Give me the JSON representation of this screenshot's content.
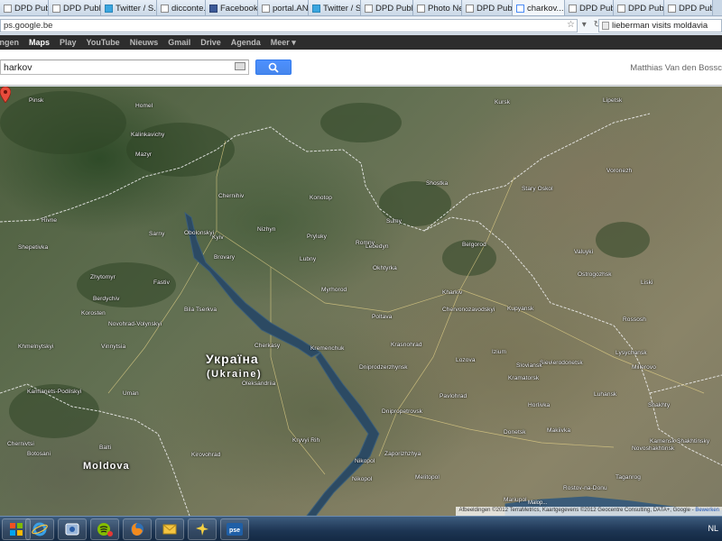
{
  "browser": {
    "tabs": [
      {
        "label": "DPD Publi...",
        "icon": "document-icon"
      },
      {
        "label": "DPD Publi...",
        "icon": "document-icon"
      },
      {
        "label": "Twitter / S...",
        "icon": "twitter-icon"
      },
      {
        "label": "dicconte...",
        "icon": "document-icon"
      },
      {
        "label": "Facebook",
        "icon": "facebook-icon"
      },
      {
        "label": "portal.AN...",
        "icon": "document-icon"
      },
      {
        "label": "Twitter / S...",
        "icon": "twitter-icon"
      },
      {
        "label": "DPD Publi...",
        "icon": "document-icon"
      },
      {
        "label": "Photo Ne...",
        "icon": "document-icon"
      },
      {
        "label": "DPD Publi...",
        "icon": "document-icon"
      },
      {
        "label": "charkov...",
        "icon": "maps-icon",
        "active": true
      },
      {
        "label": "DPD Publi...",
        "icon": "document-icon"
      },
      {
        "label": "DPD Publi...",
        "icon": "document-icon"
      },
      {
        "label": "DPD Publi...",
        "icon": "document-icon"
      }
    ],
    "url": "ps.google.be",
    "search_text": "lieberman visits moldavia"
  },
  "google_bar": {
    "items": [
      "ingen",
      "Maps",
      "Play",
      "YouTube",
      "Nieuws",
      "Gmail",
      "Drive",
      "Agenda",
      "Meer ▾"
    ],
    "selected": "Maps"
  },
  "search": {
    "query": "harkov",
    "user": "Matthias Van den Bossc"
  },
  "map": {
    "country_label": "Україна",
    "country_label_en": "(Ukraine)",
    "moldova_label": "Moldova",
    "attribution": "Afbeeldingen ©2012 TerraMetrics, Kaartgegevens ©2012 Geocentre Consulting, DATA+, Google -",
    "edit_link": "Bewerken",
    "watermark": "Malop...",
    "places": [
      {
        "name": "Pinsk"
      },
      {
        "name": "Homel"
      },
      {
        "name": "Mazyr"
      },
      {
        "name": "Kalinkavichy"
      },
      {
        "name": "Chernihiv"
      },
      {
        "name": "Konotop"
      },
      {
        "name": "Sumy"
      },
      {
        "name": "Shostka"
      },
      {
        "name": "Kursk"
      },
      {
        "name": "Belgorod"
      },
      {
        "name": "Stary Oskol"
      },
      {
        "name": "Voronezh"
      },
      {
        "name": "Lipetsk"
      },
      {
        "name": "Zhytomyr"
      },
      {
        "name": "Kyiv"
      },
      {
        "name": "Obolonskyi"
      },
      {
        "name": "Brovary"
      },
      {
        "name": "Bila Tserkva"
      },
      {
        "name": "Poltava"
      },
      {
        "name": "Lubny"
      },
      {
        "name": "Myrhorod"
      },
      {
        "name": "Kremenchuk"
      },
      {
        "name": "Cherkasy"
      },
      {
        "name": "Kharkiv"
      },
      {
        "name": "Chervonozavodskyi"
      },
      {
        "name": "Kupyansk"
      },
      {
        "name": "Sievierodonetsk"
      },
      {
        "name": "Lysychansk"
      },
      {
        "name": "Luhansk"
      },
      {
        "name": "Kramatorsk"
      },
      {
        "name": "Sloviansk"
      },
      {
        "name": "Horlivka"
      },
      {
        "name": "Donetsk"
      },
      {
        "name": "Makiivka"
      },
      {
        "name": "Pavlohrad"
      },
      {
        "name": "Dniprodzerzhynsk"
      },
      {
        "name": "Dnipropetrovsk"
      },
      {
        "name": "Zaporizhzhya"
      },
      {
        "name": "Kryvyi Rih"
      },
      {
        "name": "Nikopol"
      },
      {
        "name": "Oleksandriia"
      },
      {
        "name": "Kirovohrad"
      },
      {
        "name": "Uman"
      },
      {
        "name": "Vinnytsia"
      },
      {
        "name": "Khmelnytskyi"
      },
      {
        "name": "Kamianets-Podilskyi"
      },
      {
        "name": "Chernivtsi"
      },
      {
        "name": "Botosani"
      },
      {
        "name": "Balti"
      },
      {
        "name": "Rostov-na-Donu"
      },
      {
        "name": "Mariupol"
      },
      {
        "name": "Melitopol"
      },
      {
        "name": "Shakhty"
      },
      {
        "name": "Millerovo"
      },
      {
        "name": "Rossosh"
      },
      {
        "name": "Liski"
      },
      {
        "name": "Ostrogozhsk"
      },
      {
        "name": "Valuyki"
      },
      {
        "name": "Kamensk-Shakhtinsky"
      },
      {
        "name": "Novoshakhtinsk"
      },
      {
        "name": "Taganrog"
      },
      {
        "name": "Izium"
      },
      {
        "name": "Lozova"
      },
      {
        "name": "Krasnohrad"
      },
      {
        "name": "Okhtyrka"
      },
      {
        "name": "Lebedyn"
      },
      {
        "name": "Romny"
      },
      {
        "name": "Pryluky"
      },
      {
        "name": "Nizhyn"
      },
      {
        "name": "Fastiv"
      },
      {
        "name": "Berdychiv"
      },
      {
        "name": "Korosten"
      },
      {
        "name": "Novohrad-Volynskyi"
      },
      {
        "name": "Shepetivka"
      },
      {
        "name": "Rivne"
      },
      {
        "name": "Sarny"
      },
      {
        "name": "Nikopol"
      }
    ]
  },
  "taskbar": {
    "apps": [
      "start-orb",
      "internet-explorer",
      "remote-assistance",
      "spotify",
      "firefox",
      "outlook",
      "sky-app",
      "pse-app"
    ],
    "lang": "NL"
  },
  "colors": {
    "gbar_bg": "#2d2d2d",
    "search_btn": "#4d90fe",
    "taskbar": "#1c3452"
  }
}
